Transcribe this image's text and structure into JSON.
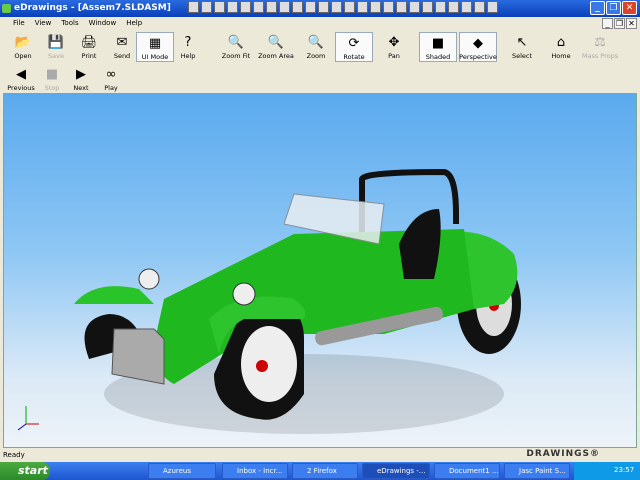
{
  "window": {
    "title": "eDrawings - [Assem7.SLDASM]"
  },
  "menu": [
    "File",
    "View",
    "Tools",
    "Window",
    "Help"
  ],
  "toolbar": [
    {
      "label": "Open",
      "icon": "folder-open-icon",
      "glyph": "📂"
    },
    {
      "label": "Save",
      "icon": "save-icon",
      "glyph": "💾",
      "disabled": true
    },
    {
      "label": "Print",
      "icon": "print-icon",
      "glyph": "🖨"
    },
    {
      "label": "Send",
      "icon": "send-icon",
      "glyph": "✉"
    },
    {
      "label": "UI Mode",
      "icon": "ui-mode-icon",
      "glyph": "▦",
      "pressed": true
    },
    {
      "label": "Help",
      "icon": "help-icon",
      "glyph": "?"
    },
    {
      "label": "Zoom Fit",
      "icon": "zoom-fit-icon",
      "glyph": "🔍"
    },
    {
      "label": "Zoom Area",
      "icon": "zoom-area-icon",
      "glyph": "🔍"
    },
    {
      "label": "Zoom",
      "icon": "zoom-icon",
      "glyph": "🔍"
    },
    {
      "label": "Rotate",
      "icon": "rotate-icon",
      "glyph": "⟳",
      "pressed": true
    },
    {
      "label": "Pan",
      "icon": "pan-icon",
      "glyph": "✥"
    },
    {
      "label": "Shaded",
      "icon": "shaded-cube-icon",
      "glyph": "■",
      "pressed": true
    },
    {
      "label": "Perspective",
      "icon": "perspective-cube-icon",
      "glyph": "◆",
      "pressed": true
    },
    {
      "label": "Select",
      "icon": "select-arrow-icon",
      "glyph": "↖"
    },
    {
      "label": "Home",
      "icon": "home-icon",
      "glyph": "⌂"
    },
    {
      "label": "Mass Props",
      "icon": "mass-props-icon",
      "glyph": "⚖",
      "disabled": true
    }
  ],
  "animation": [
    {
      "label": "Previous",
      "icon": "previous-icon",
      "glyph": "◀"
    },
    {
      "label": "Stop",
      "icon": "stop-icon",
      "glyph": "■",
      "disabled": true
    },
    {
      "label": "Next",
      "icon": "next-icon",
      "glyph": "▶"
    },
    {
      "label": "Play",
      "icon": "play-icon",
      "glyph": "∞"
    }
  ],
  "status": {
    "text": "Ready",
    "brand": "DRAWINGS®"
  },
  "taskbar": {
    "start": "start",
    "tasks": [
      "Azureus",
      "Inbox - Incr...",
      "2 Firefox",
      "eDrawings -...",
      "Document1 ...",
      "Jasc Paint S..."
    ],
    "active": 3,
    "clock": "23:57"
  },
  "colors": {
    "car_body": "#1fb81f",
    "background_top": "#5aa9ee",
    "background_bottom": "#eef3f8"
  }
}
